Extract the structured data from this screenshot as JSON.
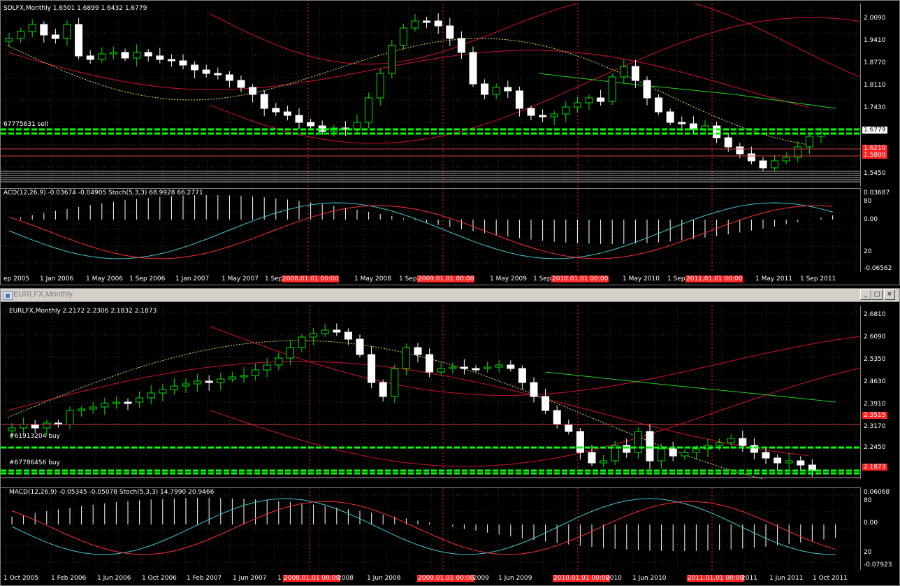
{
  "top_chart": {
    "header": "SDLFX,Monthly  1.6501 1.6899 1.6432 1.6779",
    "order_label": "67775631 sell",
    "price_axis": [
      "2.0090",
      "1.9410",
      "1.8770",
      "1.8110",
      "1.7430",
      "1.6779",
      "1.6210",
      "1.5800",
      "1.5450"
    ],
    "current_price": "1.6779",
    "red_prices": [
      "1.6210",
      "1.5800"
    ],
    "indicator_header": "ACD(12,26,9) -0.03674 -0.04905  Stoch(5,3,3) 68.9928 66.2771",
    "indicator_axis": [
      "0.03687",
      "80",
      "0.00",
      "20",
      "-0.06562"
    ],
    "dates": [
      "ep 2005",
      "1 Jan 2006",
      "1 May 2006",
      "1 Sep 2006",
      "1 Jan 2007",
      "1 May 2007",
      "1 Sep",
      "2008.01.01 00:00",
      "1 May 2008",
      "1 Sep",
      "2009.01.01 00:00",
      "1 May 2009",
      "1 Sep",
      "2010.01.01 00:00",
      "1 May 2010",
      "1 Sep",
      "2011.01.01 00:00",
      "1 May 2011",
      "1 Sep 2011"
    ]
  },
  "bottom_window": {
    "title": "EURLFX,Monthly",
    "buttons": {
      "minimize": "_",
      "maximize": "□",
      "close": "×"
    },
    "header": "EURLFX,Monthly  2.2172 2.2306 2.1832 2.1873",
    "order_labels": [
      "#61913204 buy",
      "#67786456 buy"
    ],
    "price_axis": [
      "2.6810",
      "2.6090",
      "2.5350",
      "2.4630",
      "2.3910",
      "2.3170",
      "2.2450"
    ],
    "red_prices": [
      "2.3515",
      "2.1873"
    ],
    "indicator_header": "MACD(12,26,9) -0.05345 -0.05078  Stoch(5,3,3) 14.7990 20.9466",
    "indicator_axis": [
      "0.06068",
      "80",
      "0.00",
      "20",
      "-0.07923"
    ],
    "dates": [
      "1 Oct 2005",
      "1 Feb 2006",
      "1 Jun 2006",
      "1 Oct 2006",
      "1 Feb 2007",
      "1 Jun 2007",
      "1",
      "2008.01.01 00:00",
      "2008",
      "1 Jun 2008",
      "2009.01.01 00:00",
      "2009",
      "1 Jun 2009",
      "2010.01.01 00:00",
      "2010",
      "1 Jun 2010",
      "2011.01.01 00:00",
      "2011",
      "1 Jun 2011",
      "1 Oct 2011"
    ]
  },
  "colors": {
    "bull": "#00e000",
    "bear": "#ffffff",
    "band": "#d01030",
    "grid": "#3a3a3a",
    "signal": "#00ff00",
    "vsep": "#ff2020",
    "macd": "#ffffff",
    "stoch_main": "#40c8d0",
    "stoch_sig": "#ff3030"
  }
}
